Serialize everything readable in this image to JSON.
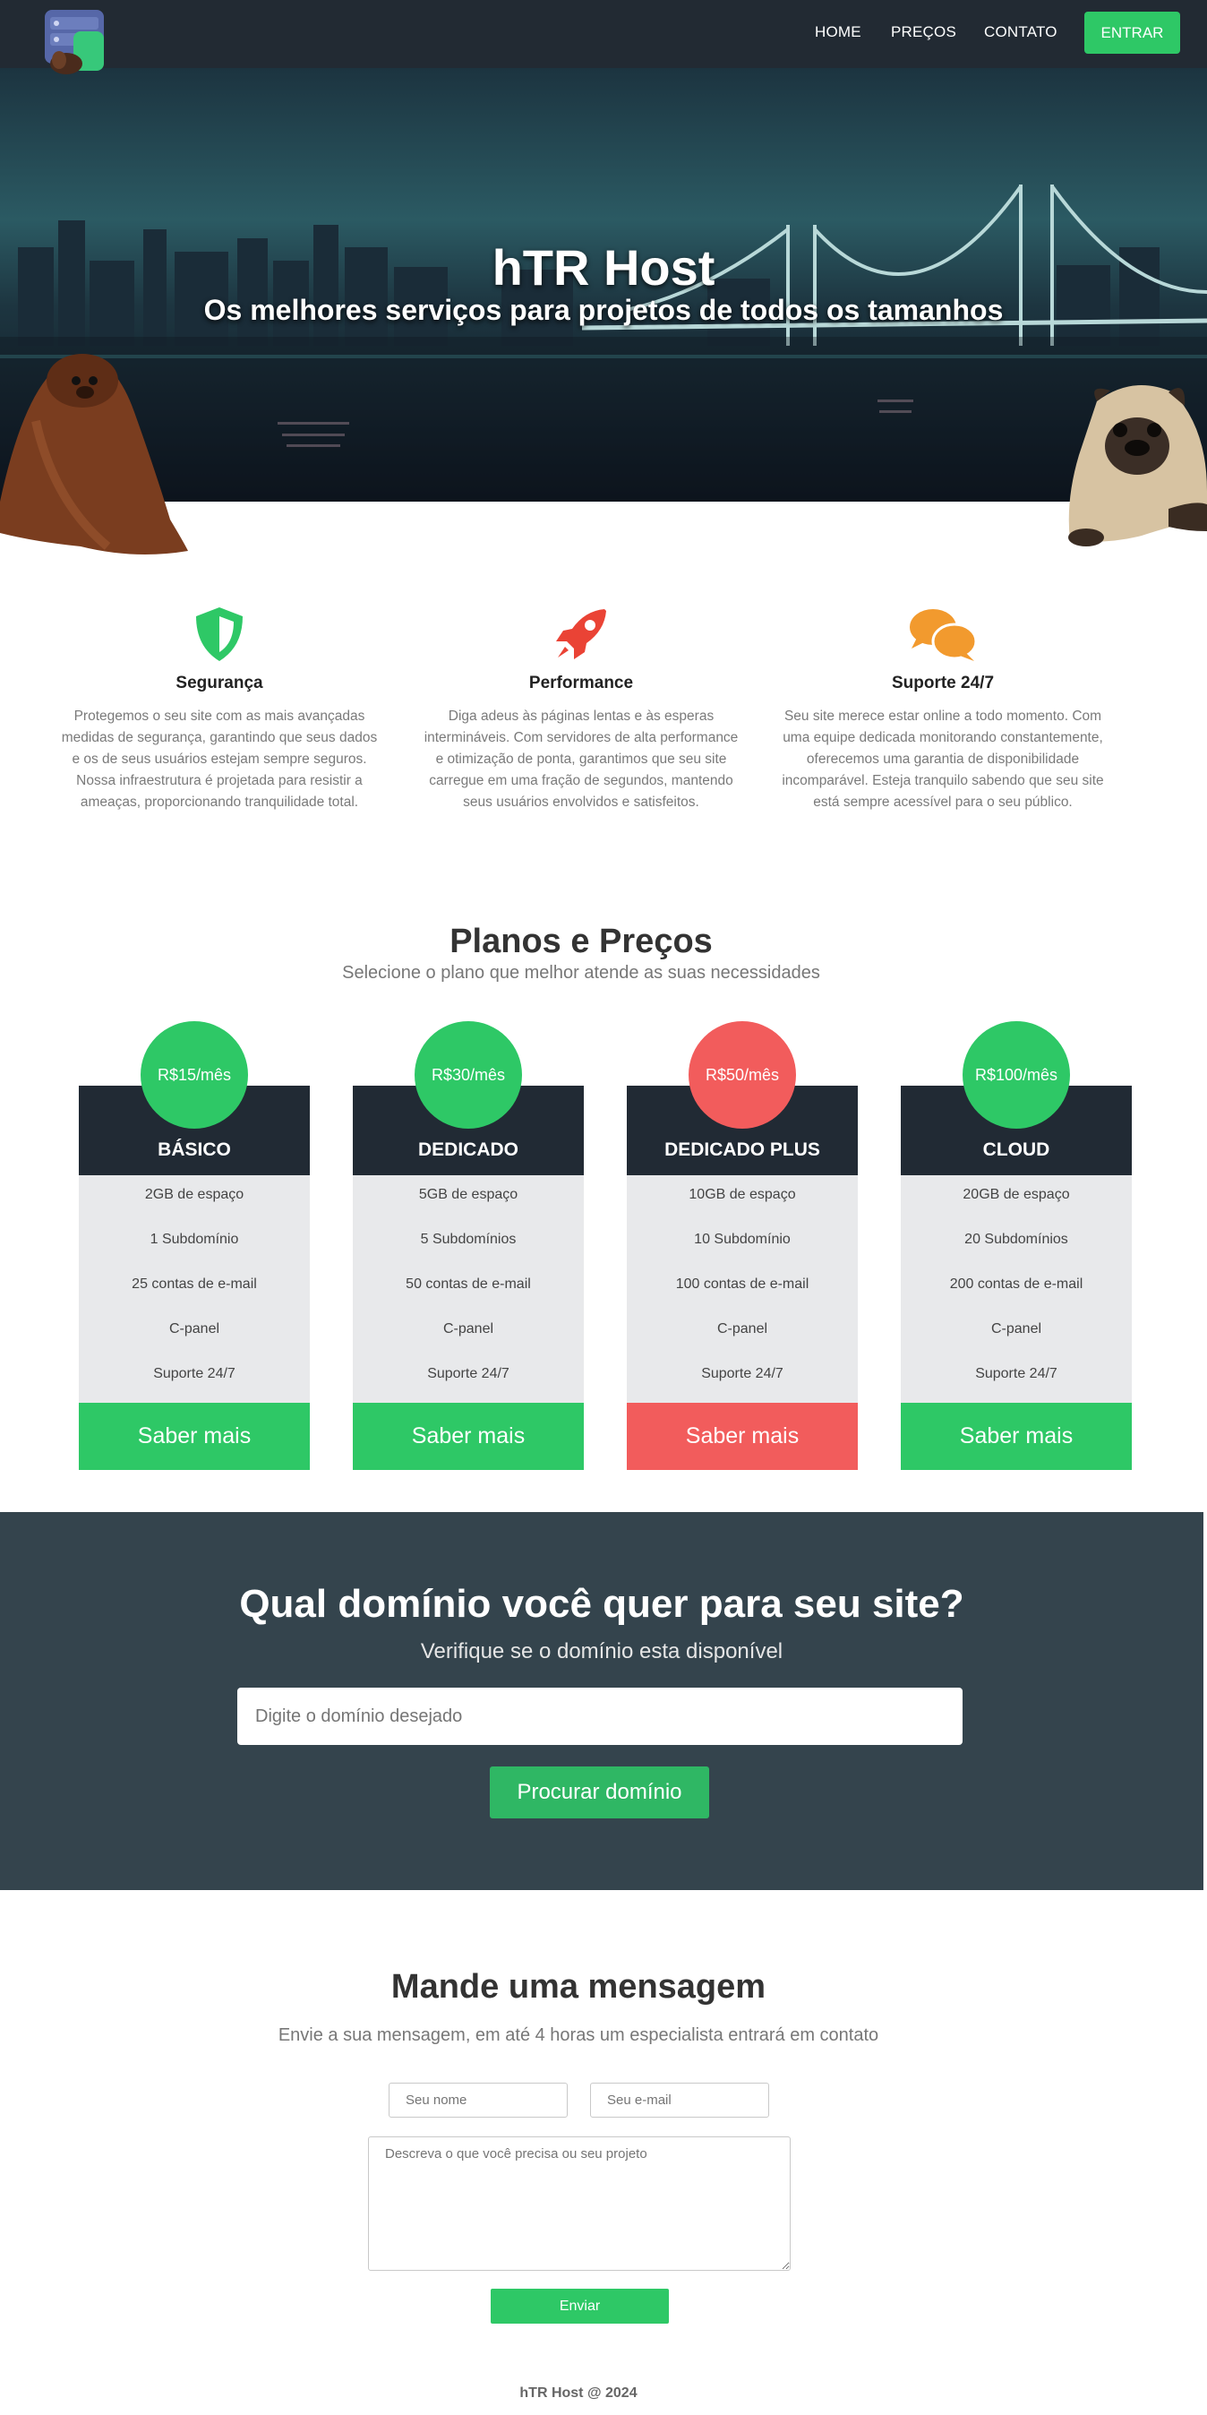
{
  "nav": {
    "logo_icon": "server-stack-logo-icon",
    "links": [
      "HOME",
      "PREÇOS",
      "CONTATO"
    ],
    "login_label": "ENTRAR"
  },
  "hero": {
    "title": "hTR Host",
    "subtitle": "Os melhores serviços para projetos de todos os tamanhos"
  },
  "features": [
    {
      "icon": "shield-icon",
      "color": "#2ec866",
      "title": "Segurança",
      "text": "Protegemos o seu site com as mais avançadas medidas de segurança, garantindo que seus dados e os de seus usuários estejam sempre seguros. Nossa infraestrutura é projetada para resistir a ameaças, proporcionando tranquilidade total."
    },
    {
      "icon": "rocket-icon",
      "color": "#ea4335",
      "title": "Performance",
      "text": "Diga adeus às páginas lentas e às esperas intermináveis. Com servidores de alta performance e otimização de ponta, garantimos que seu site carregue em uma fração de segundos, mantendo seus usuários envolvidos e satisfeitos."
    },
    {
      "icon": "chat-bubbles-icon",
      "color": "#f29a2e",
      "title": "Suporte 24/7",
      "text": "Seu site merece estar online a todo momento. Com uma equipe dedicada monitorando constantemente, oferecemos uma garantia de disponibilidade incomparável. Esteja tranquilo sabendo que seu site está sempre acessível para o seu público."
    }
  ],
  "plans_section": {
    "title": "Planos e Preços",
    "subtitle": "Selecione o plano que melhor atende as suas necessidades"
  },
  "plans": [
    {
      "price": "R$15/mês",
      "name": "BÁSICO",
      "features": [
        "2GB de espaço",
        "1 Subdomínio",
        "25 contas de e-mail",
        "C-panel",
        "Suporte 24/7"
      ],
      "button": "Saber mais",
      "accent": "#2ec866"
    },
    {
      "price": "R$30/mês",
      "name": "DEDICADO",
      "features": [
        "5GB de espaço",
        "5 Subdomínios",
        "50 contas de e-mail",
        "C-panel",
        "Suporte 24/7"
      ],
      "button": "Saber mais",
      "accent": "#2ec866"
    },
    {
      "price": "R$50/mês",
      "name": "DEDICADO PLUS",
      "features": [
        "10GB de espaço",
        "10 Subdomínio",
        "100 contas de e-mail",
        "C-panel",
        "Suporte 24/7"
      ],
      "button": "Saber mais",
      "accent": "#f25c5c"
    },
    {
      "price": "R$100/mês",
      "name": "CLOUD",
      "features": [
        "20GB de espaço",
        "20 Subdomínios",
        "200 contas de e-mail",
        "C-panel",
        "Suporte 24/7"
      ],
      "button": "Saber mais",
      "accent": "#2ec866"
    }
  ],
  "domain": {
    "title": "Qual domínio você quer para seu site?",
    "subtitle": "Verifique se o domínio esta disponível",
    "placeholder": "Digite o domínio desejado",
    "button": "Procurar domínio"
  },
  "contact": {
    "title": "Mande uma mensagem",
    "subtitle": "Envie a sua mensagem, em até 4 horas um especialista entrará em contato",
    "name_placeholder": "Seu nome",
    "email_placeholder": "Seu e-mail",
    "message_placeholder": "Descreva o que você precisa ou seu projeto",
    "send_label": "Enviar"
  },
  "footer": {
    "text": "hTR Host @ 2024"
  },
  "colors": {
    "nav_bg": "#222a33",
    "accent_green": "#2ec866",
    "accent_red": "#f25c5c",
    "domain_bg": "#34444d"
  }
}
